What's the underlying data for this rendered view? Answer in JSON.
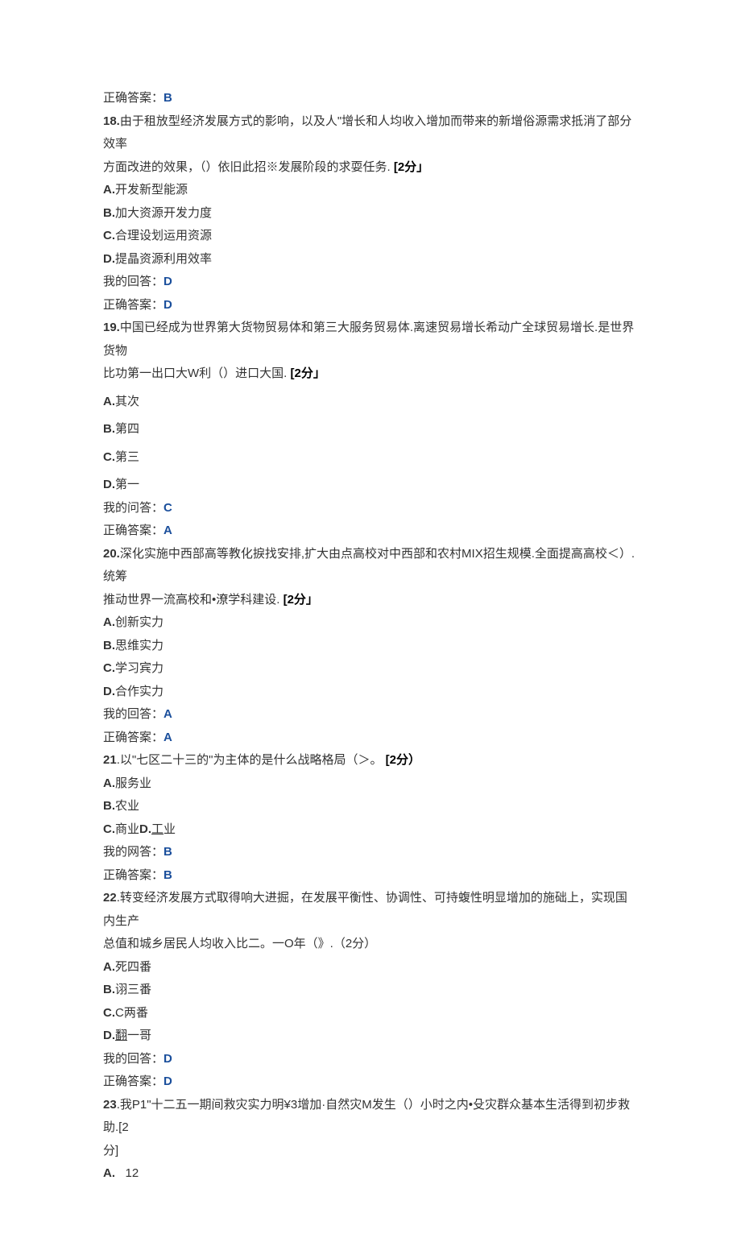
{
  "pre_correct": {
    "label": "正确答案：",
    "value": "B"
  },
  "q18": {
    "number": "18.",
    "stem1": "由于租放型经济发展方式的影响，以及人\"增长和人均收入增加而带来的新增俗源需求抵消了部分效率",
    "stem2": "方面改进的效果，（）依旧此招※发展阶段的求耍任务.",
    "score": " [2分」",
    "options": {
      "A": "开发新型能源",
      "B": "加大资源开发力度",
      "C": "合理设划运用资源",
      "D": "提晶资源利用效率"
    },
    "my_label": "我的回答：",
    "my_value": "D",
    "correct_label": "正确答案：",
    "correct_value": "D"
  },
  "q19": {
    "number": "19.",
    "stem1": "中国已经成为世界第大货物贸易体和第三大服务贸易体.离速贸易增长希动广全球贸易增长.是世界货物",
    "stem2": "比功第一出口大W利（）进口大国.",
    "score": " [2分」",
    "options": {
      "A": "其次",
      "B": "第四",
      "C": "第三",
      "D": "第一"
    },
    "my_label": "我的问答：",
    "my_value": "C",
    "correct_label": "正确答案：",
    "correct_value": "A"
  },
  "q20": {
    "number": "20.",
    "stem1": "深化实施中西部高等教化捩找安排,扩大由点高校对中西部和农村MIX招生规模.全面提高高校＜）.统筹",
    "stem2": "推动世界一流高校和•潦学科建设.",
    "score": " [2分」",
    "options": {
      "A": "创新实力",
      "B": "思维实力",
      "C": "学习宾力",
      "D": "合作实力"
    },
    "my_label": "我的回答：",
    "my_value": "A",
    "correct_label": "正确答案：",
    "correct_value": "A"
  },
  "q21": {
    "number": "21",
    "stem": ".以\"七区二十三的\"为主体的是什么战略格局（＞。",
    "score": "  [2分）",
    "options": {
      "A": "服务业",
      "B": "农业",
      "CD": "商业D.工业"
    },
    "my_label": "我的网答：",
    "my_value": "B",
    "correct_label": "正确答案：",
    "correct_value": "B"
  },
  "q22": {
    "number": "22",
    "stem1": ".转变经济发展方式取得响大进掘，在发展平衡性、协调性、可持蝮性明显增加的施础上，实现国内生产",
    "stem2": "总值和城乡居民人均收入比二。一O年（》.（2分）",
    "options": {
      "A": "死四番",
      "B": "诩三番",
      "C": "C两番",
      "D": "翻一哥"
    },
    "my_label": "我的回答：",
    "my_value": "D",
    "correct_label": "正确答案：",
    "correct_value": "D"
  },
  "q23": {
    "number": "23",
    "stem1": ".我P1\"十二五一期间救灾实力明¥3增加·自然灾M发生（）小时之内•殳灾群众基本生活得到初步救助.[2",
    "stem2": "分]",
    "options": {
      "A": "12"
    }
  }
}
